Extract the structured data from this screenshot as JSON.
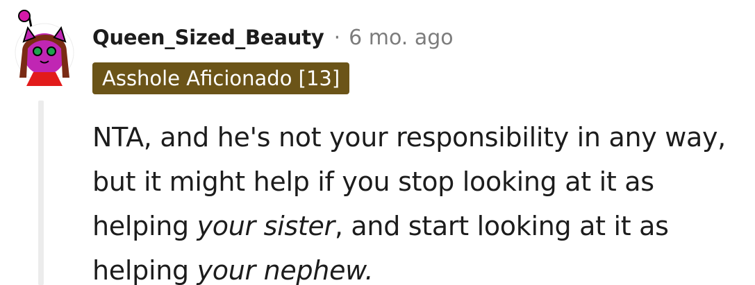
{
  "comment": {
    "username": "Queen_Sized_Beauty",
    "separator": "·",
    "timestamp": "6 mo. ago",
    "flair": "Asshole Aficionado [13]",
    "body": {
      "line1": "NTA, and he's not your responsibility in any way,",
      "line2": "but it might help if you stop looking at it as",
      "line3_pre": "helping ",
      "line3_em": "your sister",
      "line3_post": ", and start looking at it as",
      "line4_pre": "helping ",
      "line4_em": "your nephew."
    },
    "avatar_icon": "snoo-avatar-icon"
  },
  "colors": {
    "flair_bg": "#6b5418",
    "text": "#1c1c1c",
    "meta": "#7c7c7c",
    "thread_line": "#ececec"
  }
}
